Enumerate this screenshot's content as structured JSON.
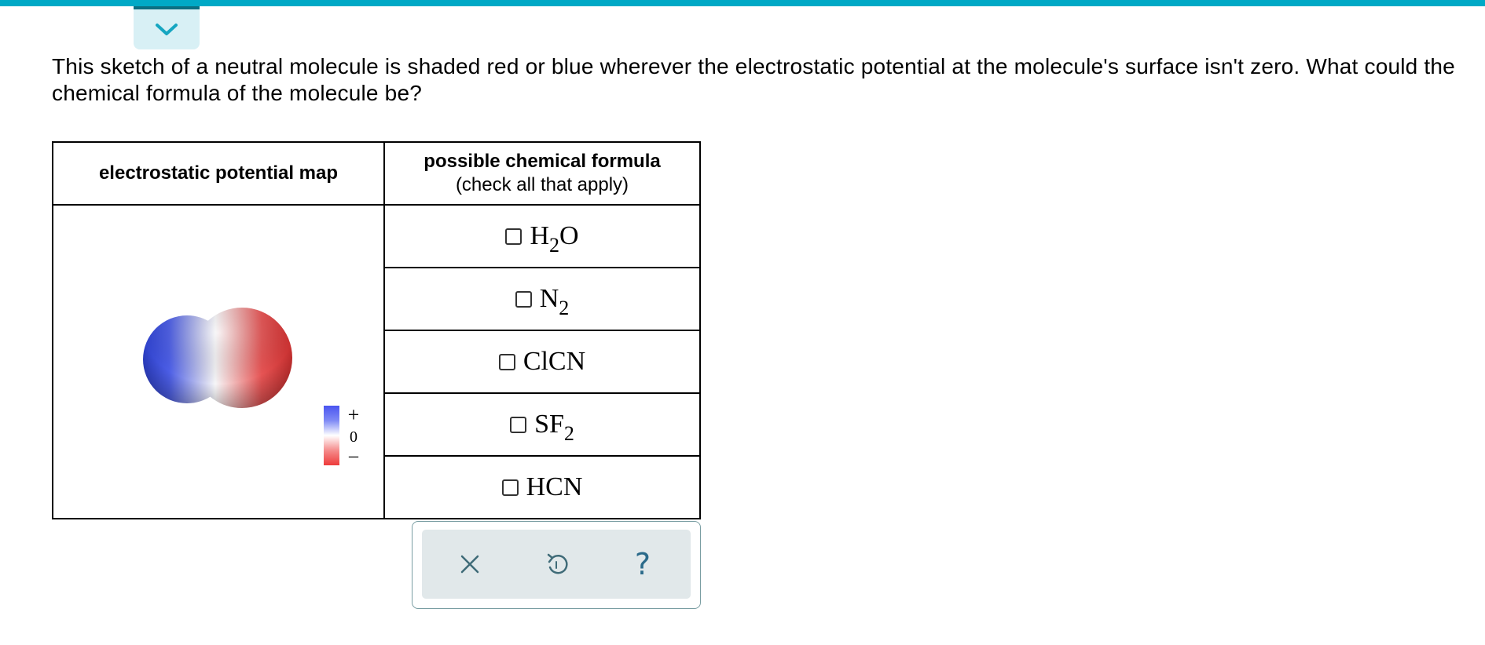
{
  "header": {
    "collapse_icon": "chevron-down-icon",
    "accent_color": "#00a9c6"
  },
  "question": {
    "text": "This sketch of a neutral molecule is shaded red or blue wherever the electrostatic potential at the molecule's surface isn't zero. What could the chemical formula of the molecule be?"
  },
  "table": {
    "col_map_header": "electrostatic potential map",
    "col_formula_header": "possible chemical formula",
    "col_formula_subheader": "(check all that apply)",
    "legend": {
      "plus": "+",
      "zero": "0",
      "minus": "–"
    },
    "options": [
      {
        "base": "H",
        "sub": "2",
        "tail": "O",
        "checked": false
      },
      {
        "base": "N",
        "sub": "2",
        "tail": "",
        "checked": false
      },
      {
        "base": "ClCN",
        "sub": "",
        "tail": "",
        "checked": false
      },
      {
        "base": "SF",
        "sub": "2",
        "tail": "",
        "checked": false
      },
      {
        "base": "HCN",
        "sub": "",
        "tail": "",
        "checked": false
      }
    ]
  },
  "tools": {
    "clear_icon": "close-icon",
    "undo_icon": "undo-icon",
    "help_icon": "help-icon",
    "help_label": "?"
  }
}
